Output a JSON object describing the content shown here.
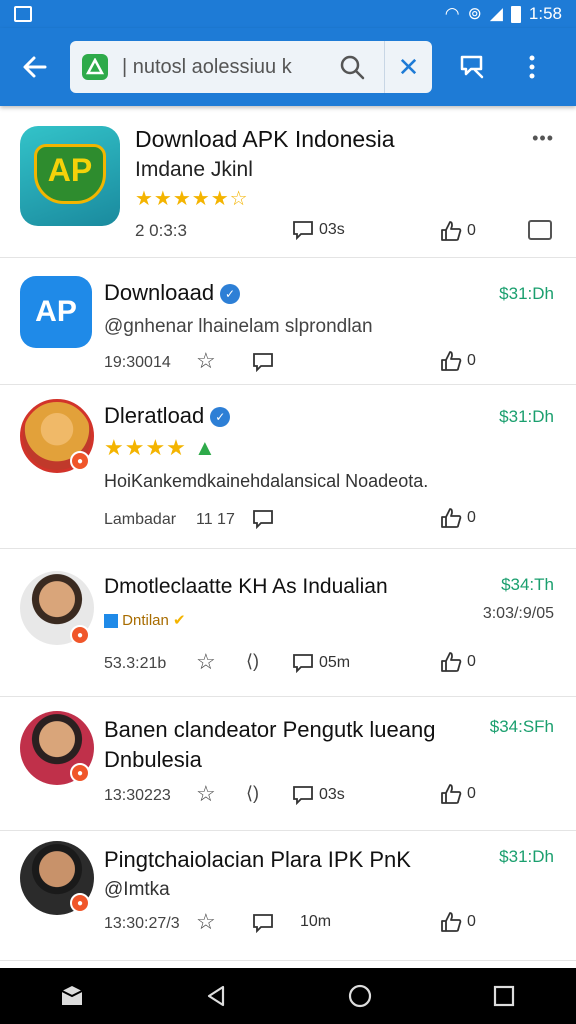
{
  "status": {
    "time": "1:58"
  },
  "search": {
    "value": "| nutosl aolessiuu k"
  },
  "items": [
    {
      "title": "Download APK Indonesia",
      "subtitle": "Imdane Jkinl",
      "stars": "★★★★★☆",
      "time": "2 0:3:3",
      "comments": "03s",
      "likes": "0"
    },
    {
      "title": "Downloaad",
      "subtitle": "@gnhenar lhainelam slprondlan",
      "price": "$31:Dh",
      "time": "19:30014",
      "likes": "0",
      "avatar_text": "AP"
    },
    {
      "title": "Dleratload",
      "subtitle": "HoiKankemdkainehdalansical Noadeota.",
      "price": "$31:Dh",
      "meta": "Lambadar",
      "meta2": "11 17",
      "likes": "0"
    },
    {
      "title": "Dmotleclaatte KH As Indualian",
      "tag": "Dntilan",
      "price": "$34:Th",
      "date": "3:03/:9/05",
      "time": "53.3:21b",
      "comments": "05m",
      "likes": "0"
    },
    {
      "title": "Banen clandeator Pengutk lueang",
      "title2": "Dnbulesia",
      "price": "$34:SFh",
      "time": "13:30223",
      "comments": "03s",
      "likes": "0"
    },
    {
      "title": "Pingtchaiolacian Plara IPK PnK",
      "subtitle": "@Imtka",
      "price": "$31:Dh",
      "time": "13:30:27/3",
      "comments": "10m",
      "likes": "0"
    }
  ],
  "colors": {
    "primary": "#1e7bd6",
    "price": "#1a9f6e",
    "star": "#f4b400",
    "badge": "#f0562a"
  }
}
